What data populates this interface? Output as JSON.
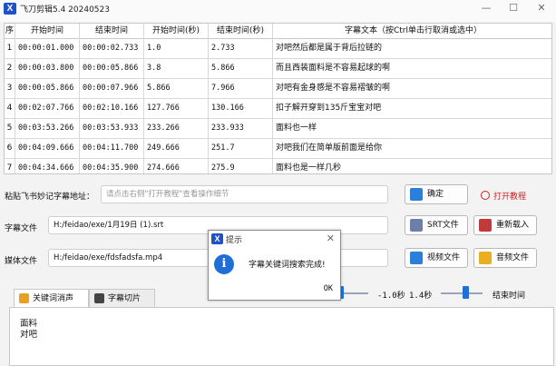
{
  "app": {
    "title": "飞刀剪辑5.4 20240523",
    "icon": "X"
  },
  "window_controls": {
    "minimize": "—",
    "maximize": "☐",
    "close": "✕"
  },
  "table": {
    "headers": [
      "序",
      "开始时间",
      "结束时间",
      "开始时间(秒)",
      "结束时间(秒)",
      "字幕文本（按Ctrl单击行取消或选中）"
    ],
    "rows": [
      [
        "1",
        "00:00:01.000",
        "00:00:02.733",
        "1.0",
        "2.733",
        "对吧然后都是属于背后拉链的"
      ],
      [
        "2",
        "00:00:03.800",
        "00:00:05.866",
        "3.8",
        "5.866",
        "而且西装面料是不容易起球的啊"
      ],
      [
        "3",
        "00:00:05.866",
        "00:00:07.966",
        "5.866",
        "7.966",
        "对吧有金身感是不容易褶皱的啊"
      ],
      [
        "4",
        "00:02:07.766",
        "00:02:10.166",
        "127.766",
        "130.166",
        "扣子解开穿到135斤宝宝对吧"
      ],
      [
        "5",
        "00:03:53.266",
        "00:03:53.933",
        "233.266",
        "233.933",
        "面料也一样"
      ],
      [
        "6",
        "00:04:09.666",
        "00:04:11.700",
        "249.666",
        "251.7",
        "对吧我们在简单版前面是给你"
      ],
      [
        "7",
        "00:04:34.666",
        "00:04:35.900",
        "274.666",
        "275.9",
        "面料也是一样几秒"
      ]
    ]
  },
  "feishu": {
    "label": "粘贴飞书妙记字幕地址：",
    "placeholder": "请点击右侧\"打开教程\"查看操作细节",
    "confirm": "确定",
    "tutorial": "打开教程"
  },
  "subtitle_file": {
    "label": "字幕文件",
    "path": "H:/feidao/exe/1月19日 (1).srt",
    "srt_button": "SRT文件",
    "reload_button": "重新载入"
  },
  "media_file": {
    "label": "媒体文件",
    "path": "H:/feidao/exe/fdsfadsfa.mp4",
    "video_button": "视频文件",
    "audio_button": "音频文件"
  },
  "timing": {
    "start_offset": "-1.0秒",
    "end_offset": "1.4秒",
    "end_label": "结束时间"
  },
  "tabs": [
    {
      "label": "关键词消声"
    },
    {
      "label": "字幕切片"
    }
  ],
  "keywords_text": "面料\n对吧",
  "dialog": {
    "title": "提示",
    "message": "字幕关键词搜索完成!",
    "ok": "OK",
    "close": "✕",
    "info_glyph": "i"
  },
  "colors": {
    "accent": "#1f6fd6",
    "tutorial_red": "#d42020"
  }
}
